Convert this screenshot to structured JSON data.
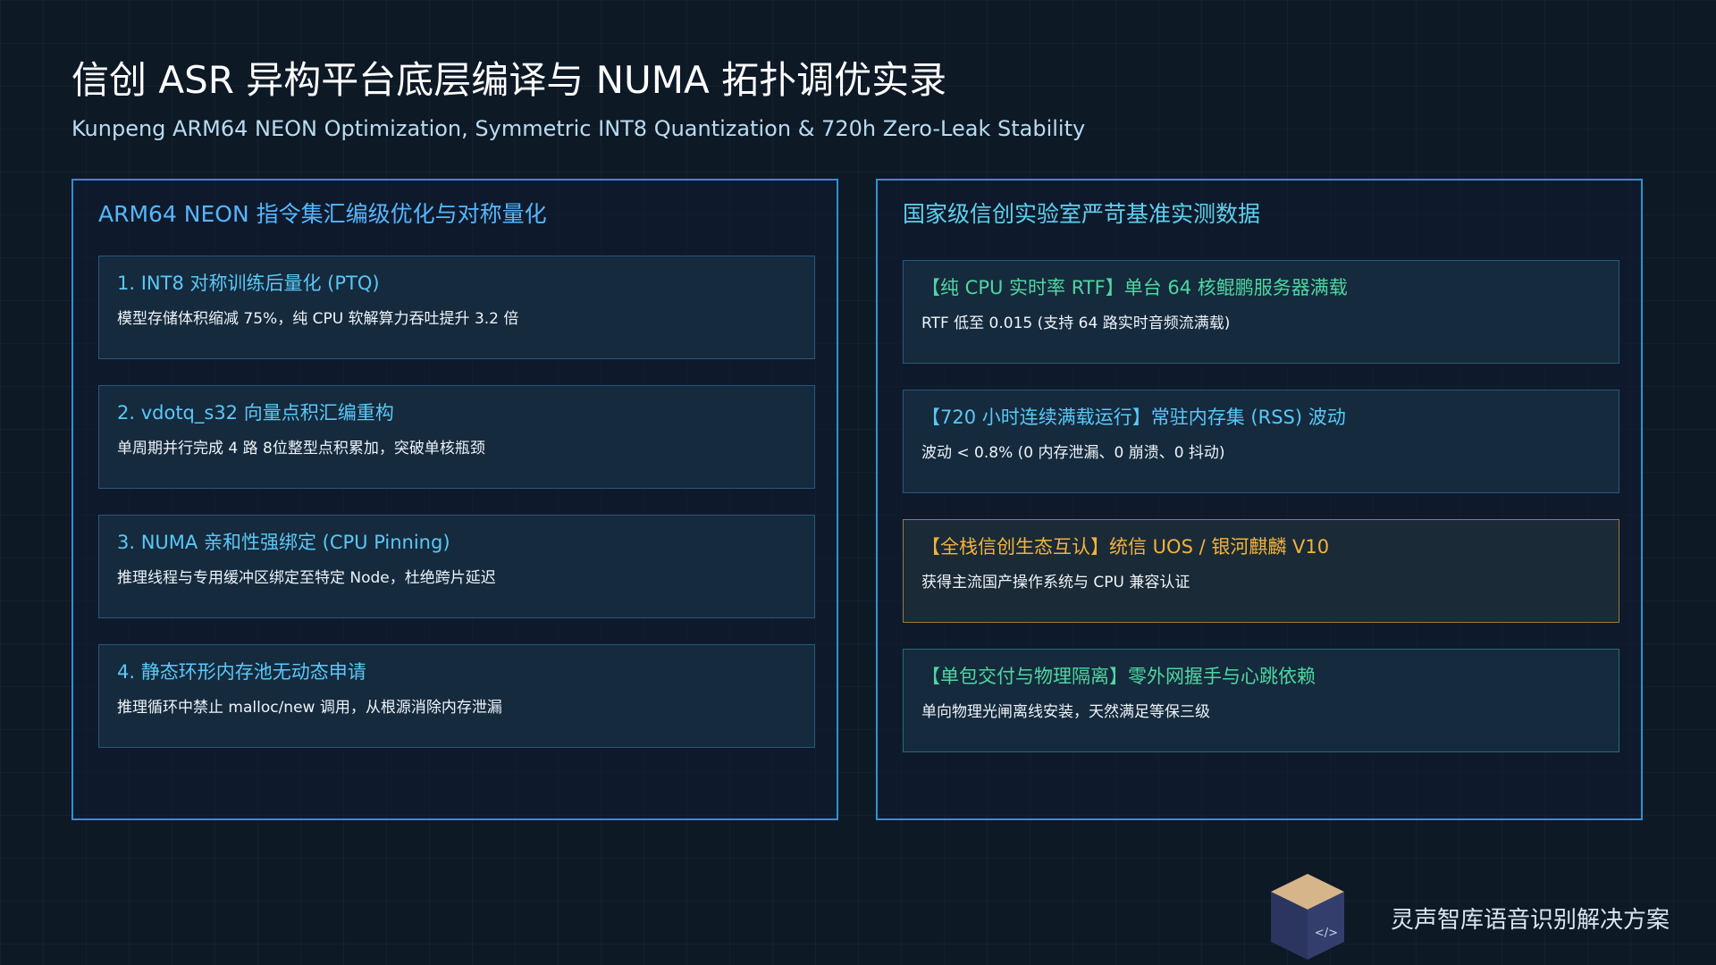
{
  "header": {
    "title": "信创 ASR 异构平台底层编译与 NUMA 拓扑调优实录",
    "subtitle": "Kunpeng ARM64 NEON Optimization, Symmetric INT8 Quantization & 720h Zero-Leak Stability"
  },
  "left_panel": {
    "title": "ARM64 NEON 指令集汇编级优化与对称量化",
    "cards": [
      {
        "title": "1. INT8 对称训练后量化 (PTQ)",
        "desc": "模型存储体积缩减 75%，纯 CPU 软解算力吞吐提升 3.2 倍"
      },
      {
        "title": "2. vdotq_s32 向量点积汇编重构",
        "desc": "单周期并行完成 4 路 8位整型点积累加，突破单核瓶颈"
      },
      {
        "title": "3. NUMA 亲和性强绑定 (CPU Pinning)",
        "desc": "推理线程与专用缓冲区绑定至特定 Node，杜绝跨片延迟"
      },
      {
        "title": "4. 静态环形内存池无动态申请",
        "desc": "推理循环中禁止 malloc/new 调用，从根源消除内存泄漏"
      }
    ]
  },
  "right_panel": {
    "title": "国家级信创实验室严苛基准实测数据",
    "cards": [
      {
        "title": "【纯 CPU 实时率 RTF】单台 64 核鲲鹏服务器满载",
        "desc": "RTF 低至 0.015 (支持 64 路实时音频流满载)",
        "accent": "#4fd6a0"
      },
      {
        "title": "【720 小时连续满载运行】常驻内存集 (RSS) 波动",
        "desc": "波动 < 0.8% (0 内存泄漏、0 崩溃、0 抖动)",
        "accent": "#5ac8f8"
      },
      {
        "title": "【全栈信创生态互认】统信 UOS / 银河麒麟 V10",
        "desc": "获得主流国产操作系统与 CPU 兼容认证",
        "accent": "#f2b33d"
      },
      {
        "title": "【单包交付与物理隔离】零外网握手与心跳依赖",
        "desc": "单向物理光闸离线安装，天然满足等保三级",
        "accent": "#4fd6a0"
      }
    ]
  },
  "footer": {
    "brand_name": "灵声智库语音识别解决方案",
    "logo_icon": "code-cube-icon",
    "logo_glyph": "</>"
  },
  "colors": {
    "background": "#0e1926",
    "panel_border": "#2f8fd6",
    "accent_blue": "#57b6ff",
    "accent_cyan": "#5ac8f8",
    "accent_green": "#4fd6a0",
    "accent_orange": "#f2b33d"
  }
}
